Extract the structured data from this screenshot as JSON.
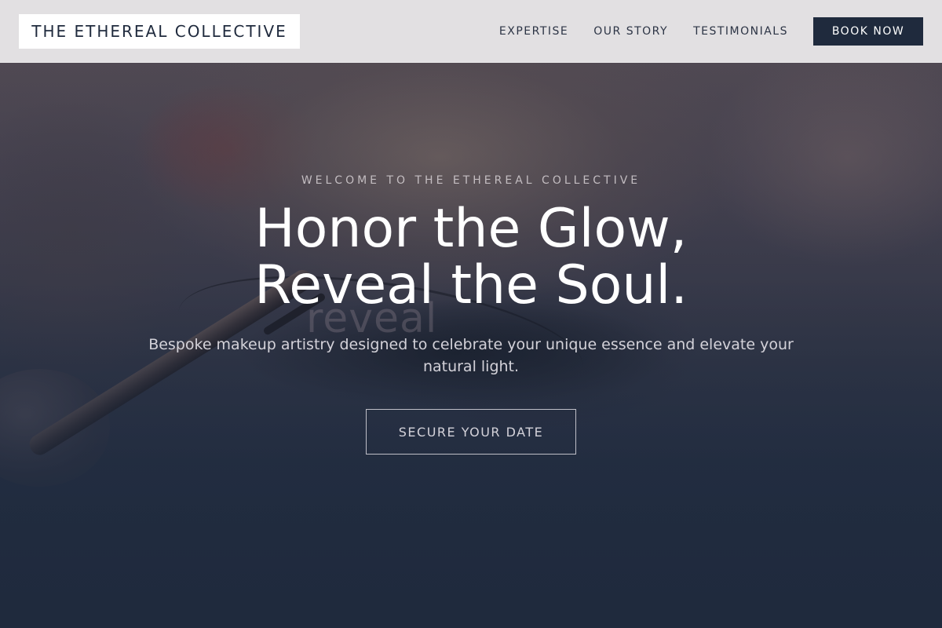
{
  "header": {
    "logo_text": "THE ETHEREAL COLLECTIVE",
    "nav": [
      {
        "label": "EXPERTISE"
      },
      {
        "label": "OUR STORY"
      },
      {
        "label": "TESTIMONIALS"
      }
    ],
    "book_button_label": "BOOK NOW"
  },
  "hero": {
    "eyebrow": "WELCOME TO THE ETHEREAL COLLECTIVE",
    "headline_line1": "Honor the Glow,",
    "headline_line2": "Reveal the Soul.",
    "ghost_word": "reveal",
    "subtext": "Bespoke makeup artistry designed to celebrate your unique essence and elevate your natural light.",
    "cta_label": "SECURE YOUR DATE"
  },
  "colors": {
    "primary_navy": "#1f2a3d",
    "header_bg": "#e8e6e8",
    "text_white": "#ffffff"
  }
}
